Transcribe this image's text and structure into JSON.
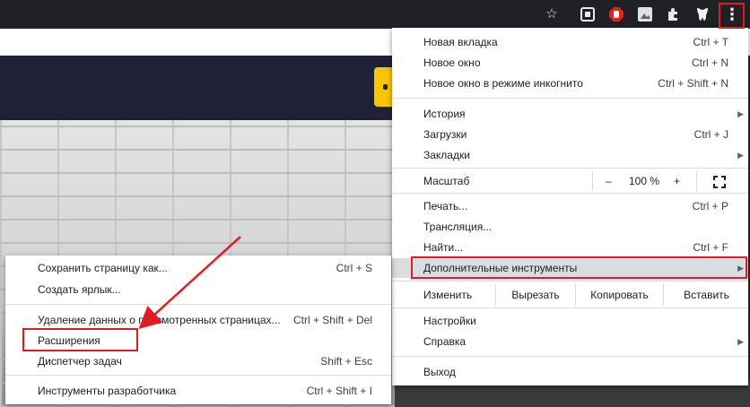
{
  "toolbar": {
    "star_icon": "☆",
    "menu_icon": "⋮"
  },
  "main_menu": {
    "new_tab": {
      "label": "Новая вкладка",
      "shortcut": "Ctrl + T"
    },
    "new_window": {
      "label": "Новое окно",
      "shortcut": "Ctrl + N"
    },
    "incognito": {
      "label": "Новое окно в режиме инкогнито",
      "shortcut": "Ctrl + Shift + N"
    },
    "history": {
      "label": "История"
    },
    "downloads": {
      "label": "Загрузки",
      "shortcut": "Ctrl + J"
    },
    "bookmarks": {
      "label": "Закладки"
    },
    "zoom": {
      "label": "Масштаб",
      "minus": "–",
      "value": "100 %",
      "plus": "+"
    },
    "print": {
      "label": "Печать...",
      "shortcut": "Ctrl + P"
    },
    "cast": {
      "label": "Трансляция..."
    },
    "find": {
      "label": "Найти...",
      "shortcut": "Ctrl + F"
    },
    "more_tools": {
      "label": "Дополнительные инструменты"
    },
    "edit": {
      "label": "Изменить",
      "cut": "Вырезать",
      "copy": "Копировать",
      "paste": "Вставить"
    },
    "settings": {
      "label": "Настройки"
    },
    "help": {
      "label": "Справка"
    },
    "exit": {
      "label": "Выход"
    }
  },
  "sub_menu": {
    "save_page": {
      "label": "Сохранить страницу как...",
      "shortcut": "Ctrl + S"
    },
    "create_shortcut": {
      "label": "Создать ярлык..."
    },
    "clear_data": {
      "label": "Удаление данных о просмотренных страницах...",
      "shortcut": "Ctrl + Shift + Del"
    },
    "extensions": {
      "label": "Расширения"
    },
    "task_manager": {
      "label": "Диспетчер задач",
      "shortcut": "Shift + Esc"
    },
    "dev_tools": {
      "label": "Инструменты разработчика",
      "shortcut": "Ctrl + Shift + I"
    }
  },
  "colors": {
    "highlight": "#e01b24",
    "menu_bg": "#ffffff",
    "topbar": "#202124"
  }
}
